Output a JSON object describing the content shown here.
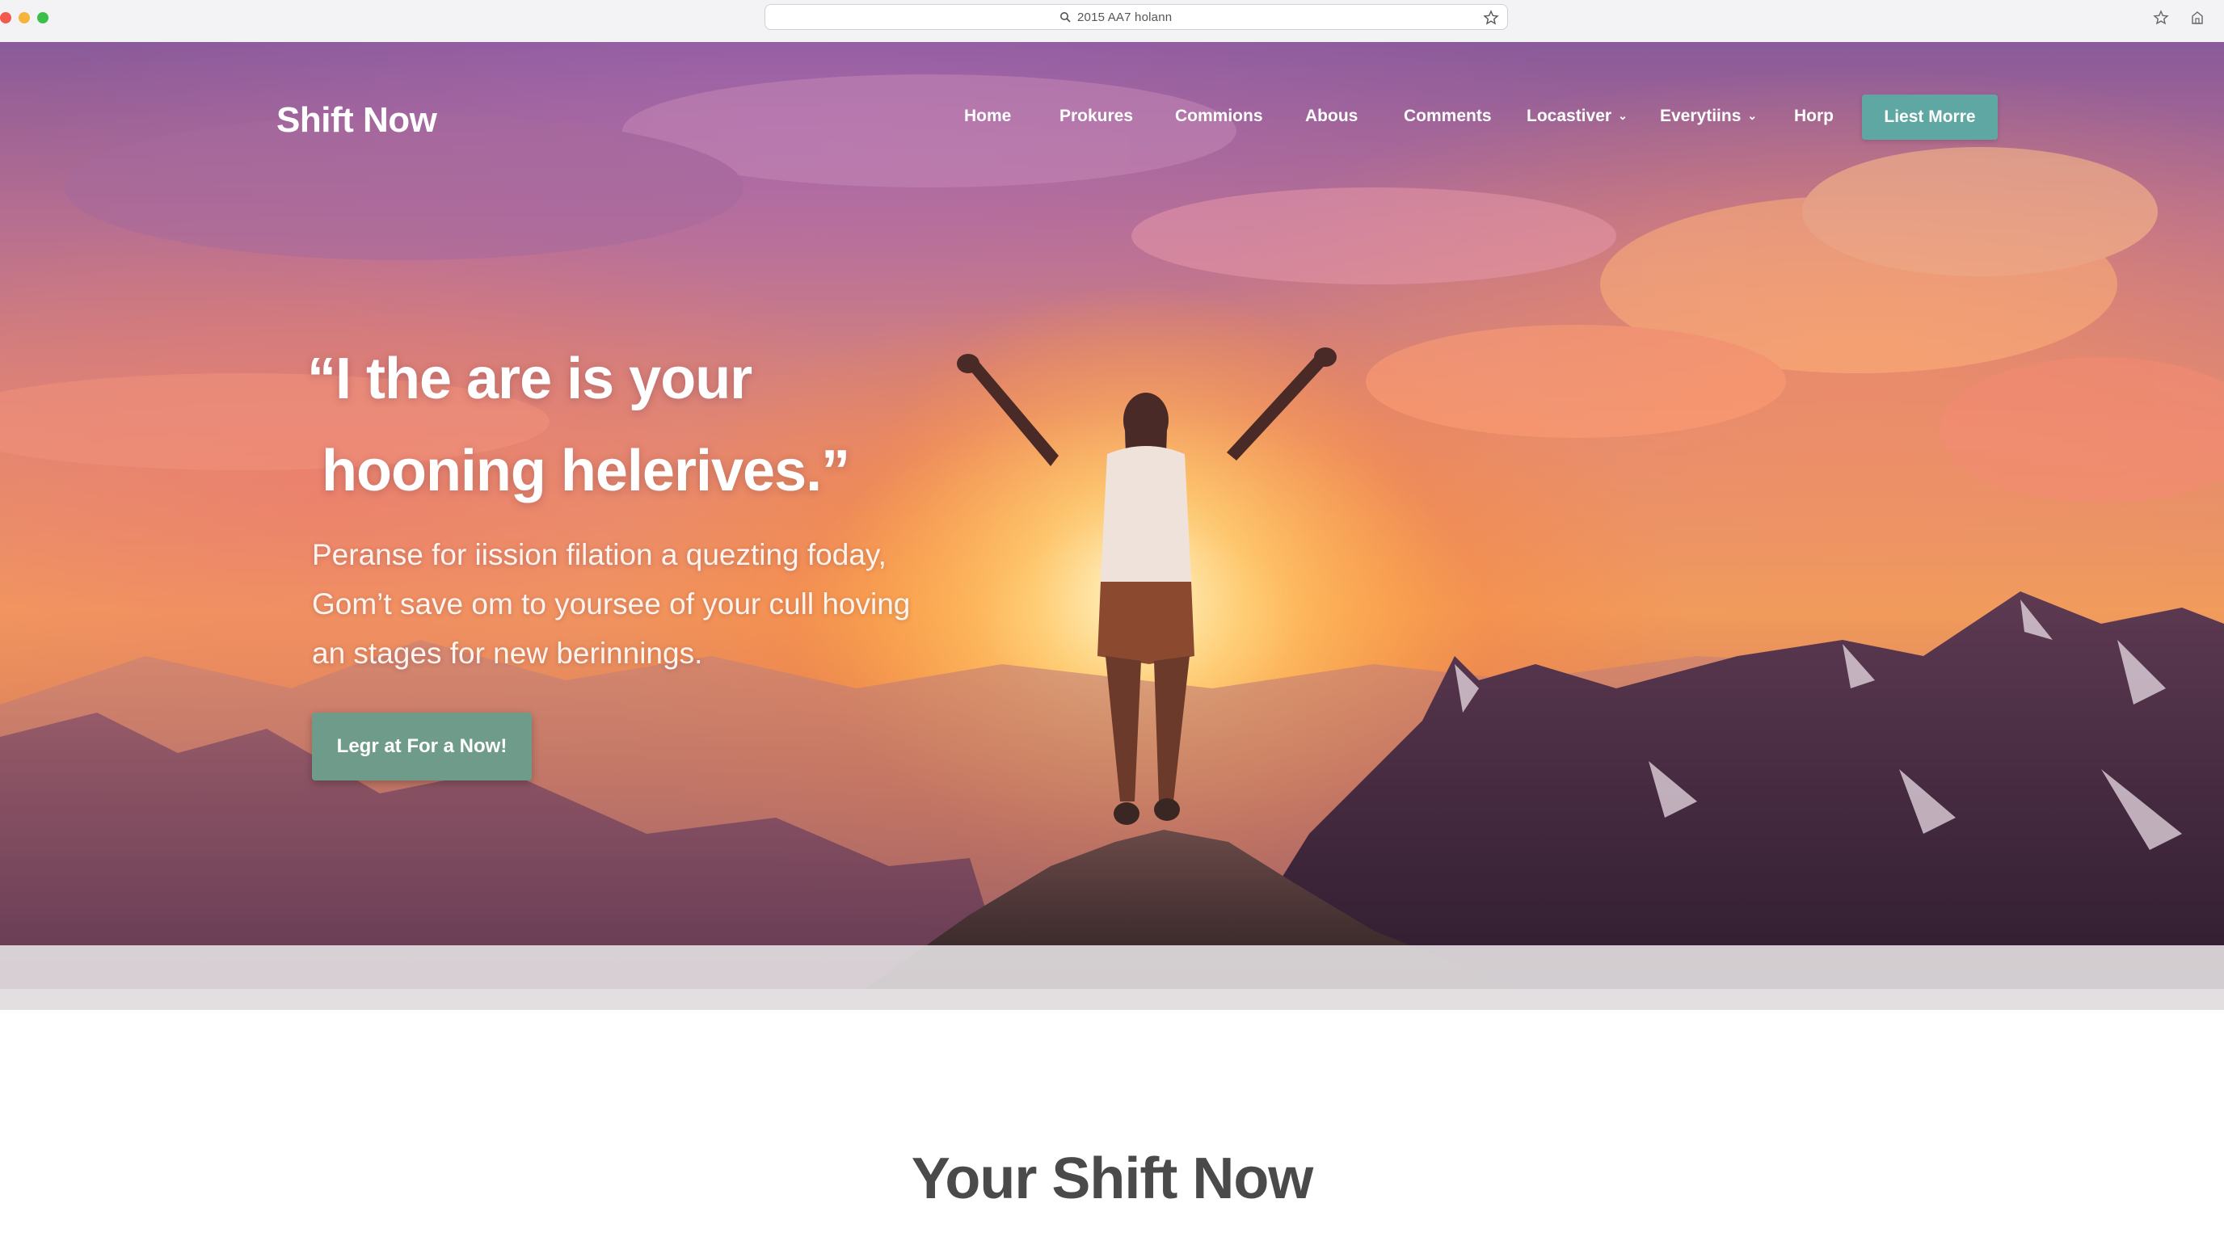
{
  "browser": {
    "url": "2015 AA7 holann",
    "icons": [
      "search-icon",
      "bookmark-star-icon",
      "extensions-icon"
    ]
  },
  "site": {
    "logo": "Shift Now",
    "nav": [
      {
        "label": "Home",
        "dropdown": false
      },
      {
        "label": "Prokures",
        "dropdown": false
      },
      {
        "label": "Commions",
        "dropdown": false
      },
      {
        "label": "Abous",
        "dropdown": false
      },
      {
        "label": "Comments",
        "dropdown": false
      },
      {
        "label": "Locastiver",
        "dropdown": true
      },
      {
        "label": "Everytiins",
        "dropdown": true
      },
      {
        "label": "Horp",
        "dropdown": false
      }
    ],
    "nav_cta": "Liest Morre"
  },
  "hero": {
    "headline_line1": "“I the are is your",
    "headline_line2": "hooning helerives.”",
    "subtext_lines": [
      "Peranse for iission filation a quezting foday,",
      "Gom’t save om to yoursee of your cull hoving",
      "an stages for new berinnings."
    ],
    "cta": "Legr at For a Now!"
  },
  "section": {
    "title": "Your Shift Now"
  },
  "colors": {
    "nav_cta_bg": "#5fa7a2",
    "hero_cta_bg": "#6f9c8a",
    "section_title": "#4a4a4a"
  }
}
